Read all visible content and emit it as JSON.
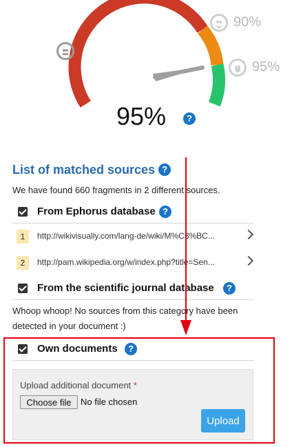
{
  "gauge": {
    "score_percent": 95,
    "score_text": "95%",
    "tick_90_label": "90%",
    "tick_95_label": "95%",
    "colors": {
      "red": "#cb3a27",
      "orange": "#ec8a13",
      "green": "#27c46b",
      "needle": "#a0a0a0"
    },
    "faces": [
      "neutral-face-icon",
      "smile-face-icon",
      "grin-face-icon"
    ]
  },
  "matched": {
    "heading": "List of matched sources",
    "summary": "We have found 660 fragments in 2 different sources."
  },
  "ephorus": {
    "title": "From Ephorus database",
    "sources": [
      {
        "num": "1",
        "url": "http://wikivisually.com/lang-de/wiki/M%C3%BC..."
      },
      {
        "num": "2",
        "url": "http://pam.wikipedia.org/w/index.php?title=Sen..."
      }
    ]
  },
  "journal": {
    "title": "From the scientific journal database",
    "empty_text": "Whoop whoop! No sources from this category have been detected in your document :)"
  },
  "own": {
    "title": "Own documents",
    "upload_label": "Upload additional document",
    "required_mark": "*",
    "choose_file": "Choose file",
    "no_file": "No file chosen",
    "upload_button": "Upload"
  },
  "annotation_color": "#e3000f"
}
